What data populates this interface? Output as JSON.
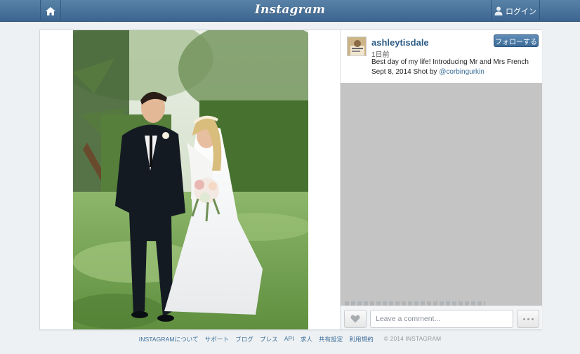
{
  "topbar": {
    "brand": "Instagram",
    "home_icon": "home-icon",
    "login_label": "ログイン",
    "login_icon": "user-icon",
    "bg_color": "#3b6590"
  },
  "post": {
    "username": "ashleytisdale",
    "follow_label": "フォローする",
    "time": "1日前",
    "caption_line1": "Best day of my life! Introducing Mr and Mrs French",
    "caption_line2_prefix": "Sept 8, 2014 Shot by ",
    "mention": "@corbingurkin",
    "photo_subject": "wedding-photo"
  },
  "actions": {
    "like_icon": "heart-icon",
    "comment_placeholder": "Leave a comment...",
    "more_icon": "more-icon"
  },
  "footer": {
    "links": [
      "INSTAGRAMについて",
      "サポート",
      "ブログ",
      "プレス",
      "API",
      "求人",
      "共有設定",
      "利用規約"
    ],
    "copyright": "© 2014 INSTAGRAM"
  }
}
